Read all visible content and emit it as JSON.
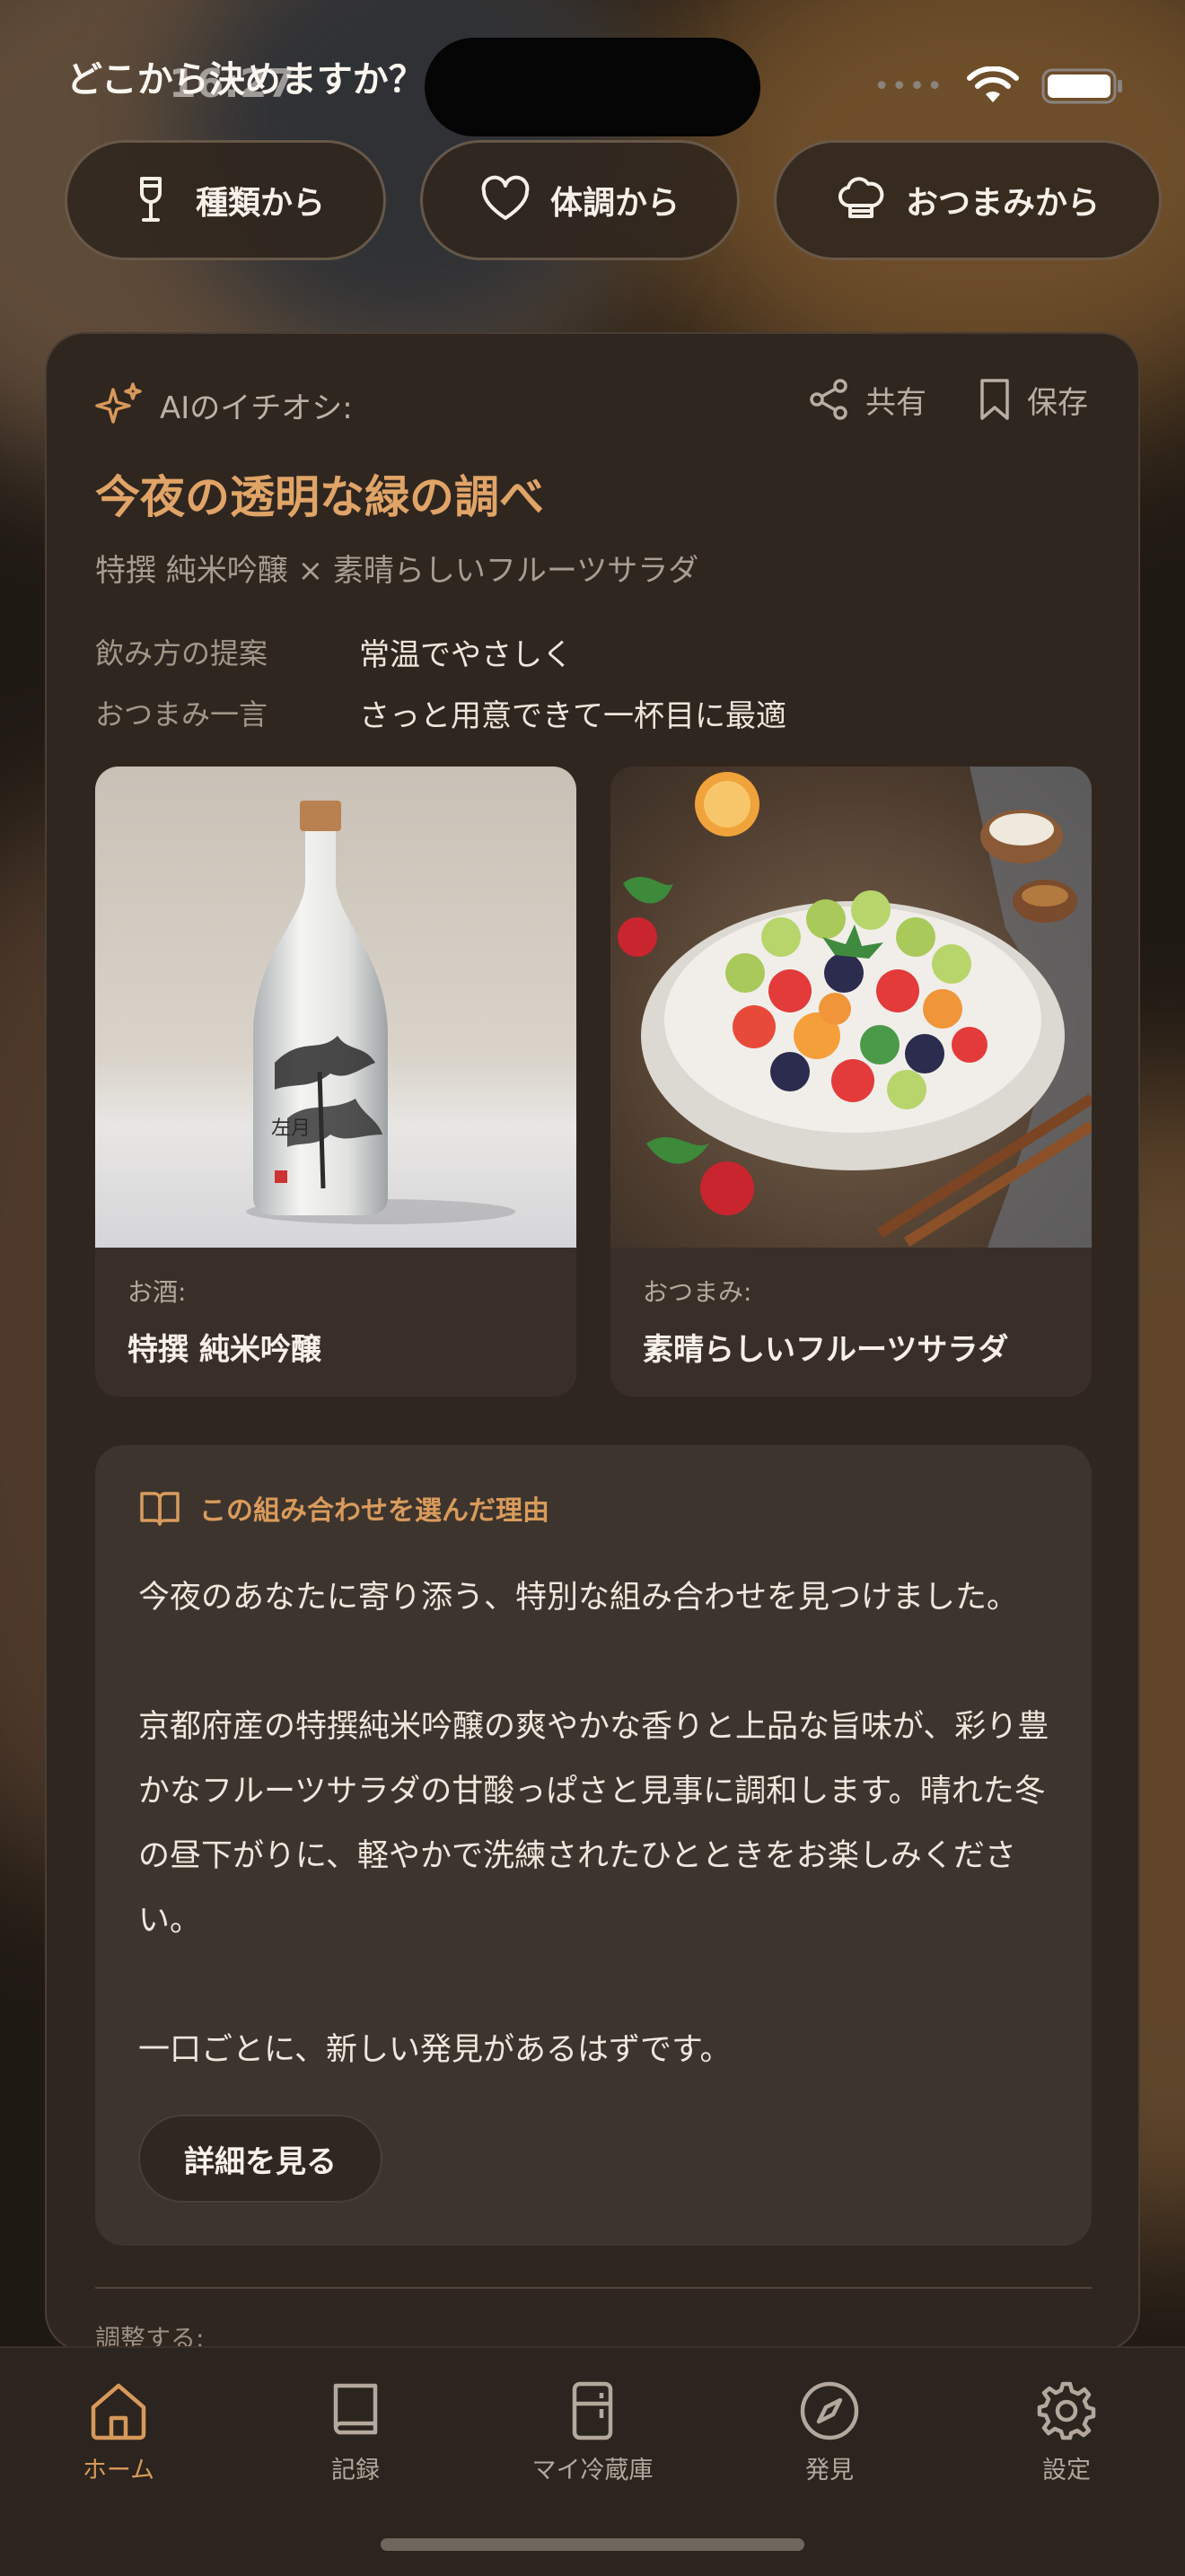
{
  "status": {
    "time": "16:27"
  },
  "page": {
    "question": "どこから決めますか？"
  },
  "chips": [
    {
      "label": "種類から",
      "icon": "wine-glass-icon"
    },
    {
      "label": "体調から",
      "icon": "heart-icon"
    },
    {
      "label": "おつまみから",
      "icon": "chef-hat-icon"
    }
  ],
  "card": {
    "ai_label": "AIのイチオシ:",
    "share_label": "共有",
    "save_label": "保存",
    "title": "今夜の透明な緑の調べ",
    "subtitle": "特撰 純米吟醸 × 素晴らしいフルーツサラダ",
    "info": [
      {
        "key": "飲み方の提案",
        "value": "常温でやさしく"
      },
      {
        "key": "おつまみ一言",
        "value": "さっと用意できて一杯目に最適"
      }
    ],
    "sake": {
      "caption_key": "お酒:",
      "caption_value": "特撰 純米吟醸",
      "label_text": "左月"
    },
    "snack": {
      "caption_key": "おつまみ:",
      "caption_value": "素晴らしいフルーツサラダ"
    },
    "reason": {
      "heading": "この組み合わせを選んだ理由",
      "p1": "今夜のあなたに寄り添う、特別な組み合わせを見つけました。",
      "p2": "京都府産の特撰純米吟醸の爽やかな香りと上品な旨味が、彩り豊かなフルーツサラダの甘酸っぱさと見事に調和します。晴れた冬の昼下がりに、軽やかで洗練されたひとときをお楽しみください。",
      "p3": "一口ごとに、新しい発見があるはずです。",
      "detail_button": "詳細を見る"
    },
    "adjust_label": "調整する:"
  },
  "tabbar": [
    {
      "label": "ホーム",
      "icon": "home-icon",
      "active": true
    },
    {
      "label": "記録",
      "icon": "book-icon",
      "active": false
    },
    {
      "label": "マイ冷蔵庫",
      "icon": "fridge-icon",
      "active": false
    },
    {
      "label": "発見",
      "icon": "compass-icon",
      "active": false
    },
    {
      "label": "設定",
      "icon": "gear-icon",
      "active": false
    }
  ],
  "colors": {
    "accent": "#d7995a",
    "title": "#e0a467",
    "card": "#302620"
  }
}
